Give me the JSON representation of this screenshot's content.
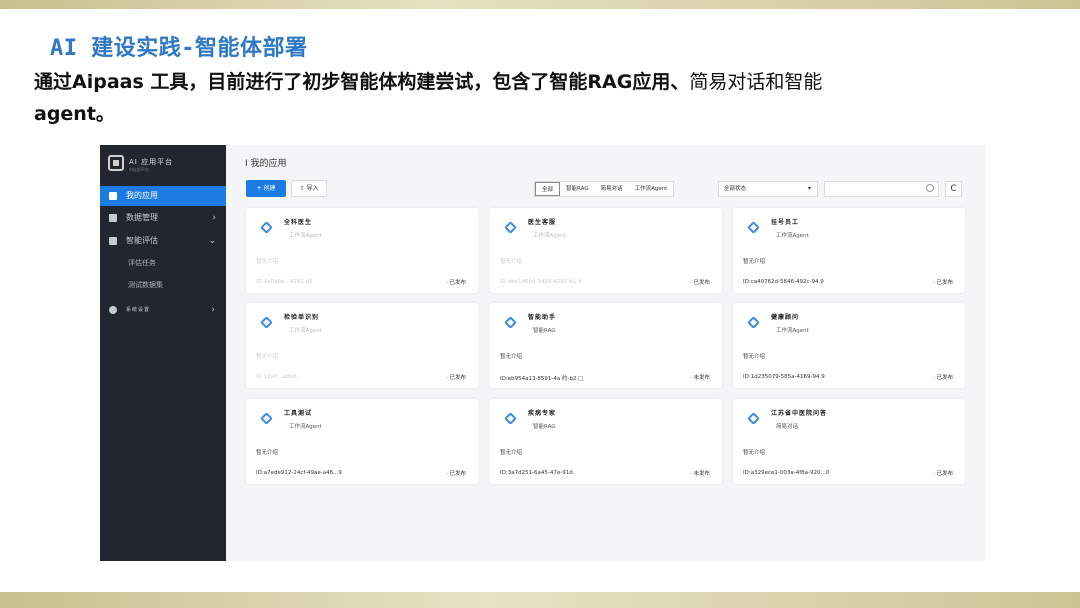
{
  "slide": {
    "title": "AI 建设实践-智能体部署",
    "text_bold": "通过Aipaas 工具，目前进行了初步智能体构建尝试，包含了智能RAG应用、",
    "text_normal": "简易对话和智能",
    "text_bold2": "agent。"
  },
  "app": {
    "brand": "AI 应用平台",
    "brand_sub": "AI应用平台",
    "nav": [
      {
        "label": "我的应用",
        "icon": "grid-icon"
      },
      {
        "label": "数据管理",
        "icon": "database-icon",
        "arrow": "›"
      },
      {
        "label": "智能评估",
        "icon": "eval-icon",
        "arrow": "⌄"
      },
      {
        "label": "评估任务"
      },
      {
        "label": "测试数据集"
      },
      {
        "label": "系统设置",
        "icon": "gear-icon",
        "arrow": "›"
      }
    ],
    "page_title": "I 我的应用",
    "create_label": "+ 创建",
    "import_label": "导入",
    "filters": [
      "全部",
      "智能RAG",
      "简易对话",
      "工作流Agent"
    ],
    "status_select": "全部状态",
    "search_placeholder": "",
    "refresh": "C",
    "cards": [
      {
        "name": "全科医生",
        "type": "工作流Agent",
        "desc": "暂无介绍",
        "id": "ID:4a0d8e...4291-b1",
        "status": "· 已发布",
        "faint": true
      },
      {
        "name": "医生客服",
        "type": "工作流Agent",
        "desc": "暂无介绍",
        "id": "ID:abe1d6b4-3d20-4291-b1.9",
        "status": "· 已发布",
        "faint": true
      },
      {
        "name": "挂号员工",
        "type": "工作流Agent",
        "desc": "暂无介绍",
        "id": "ID:ca40762d-5646-492c-94.9",
        "status": "· 已发布",
        "faint": false
      },
      {
        "name": "检验单识别",
        "type": "工作流Agent",
        "desc": "暂无介绍",
        "id": "ID:12a0...a8b8...",
        "status": "· 已发布",
        "faint": true
      },
      {
        "name": "智能助手",
        "type": "智能RAG",
        "desc": "暂无介绍",
        "id": "ID:eb954a13-8591-4a    约-b2.□",
        "status": "· 未发布",
        "faint": false
      },
      {
        "name": "健康顾问",
        "type": "工作流Agent",
        "desc": "暂无介绍",
        "id": "ID:1d235079-585a-4169-94.9",
        "status": "· 已发布",
        "faint": false
      },
      {
        "name": "工具测试",
        "type": "工作流Agent",
        "desc": "暂无介绍",
        "id": "ID:a7ede912-24cf-49ae-a46...9",
        "status": "· 已发布",
        "faint": false
      },
      {
        "name": "疾病专家",
        "type": "智能RAG",
        "desc": "暂无介绍",
        "id": "ID:3a7d251-6a45-47e-91d.",
        "status": "· 未发布",
        "faint": false
      },
      {
        "name": "江苏省中医院问答",
        "type": "简易对话",
        "desc": "暂无介绍",
        "id": "ID:a329ece1-003a-4f8a-920...0",
        "status": "· 已发布",
        "faint": false
      }
    ]
  },
  "colors": {
    "accent": "#1c7be2",
    "title_blue": "#2e78c6",
    "sidebar": "#22262e"
  }
}
